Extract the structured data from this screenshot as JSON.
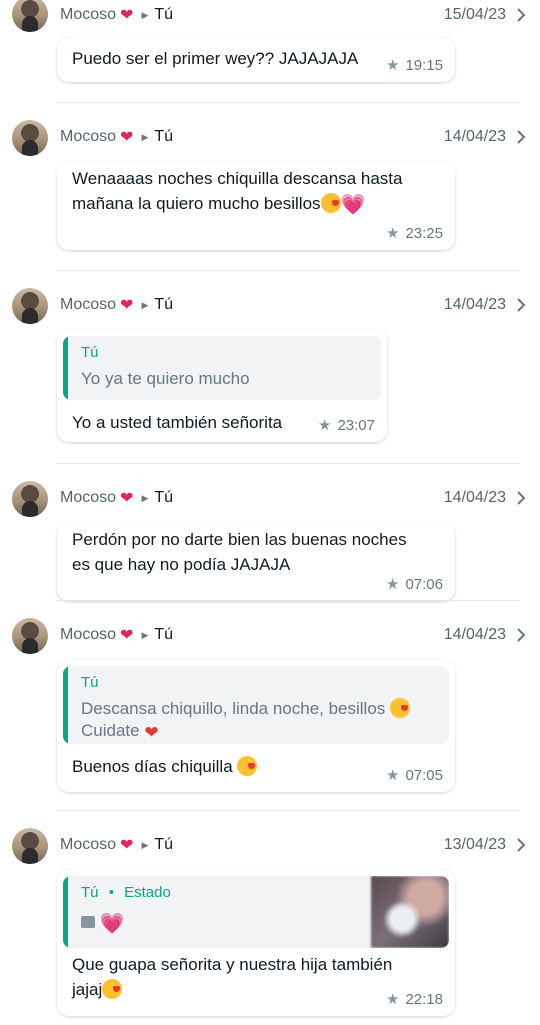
{
  "messages": [
    {
      "sender": "Mocoso",
      "recipient": "Tú",
      "date": "15/04/23",
      "text": "Puedo ser el primer wey?? JAJAJAJA",
      "time": "19:15"
    },
    {
      "sender": "Mocoso",
      "recipient": "Tú",
      "date": "14/04/23",
      "text_line1": "Wenaaaas noches chiquilla descansa hasta",
      "text_line2": "mañana la quiero mucho besillos",
      "time": "23:25"
    },
    {
      "sender": "Mocoso",
      "recipient": "Tú",
      "date": "14/04/23",
      "quote_author": "Tú",
      "quote_text": "Yo ya te quiero mucho",
      "text": "Yo a usted también señorita",
      "time": "23:07"
    },
    {
      "sender": "Mocoso",
      "recipient": "Tú",
      "date": "14/04/23",
      "text_line1": "Perdón por no darte bien las buenas noches",
      "text_line2": "es que hay no podía JAJAJA",
      "time": "07:06"
    },
    {
      "sender": "Mocoso",
      "recipient": "Tú",
      "date": "14/04/23",
      "quote_author": "Tú",
      "quote_line1": "Descansa chiquillo, linda noche, besillos",
      "quote_line2": "Cuidate",
      "text": "Buenos días chiquilla",
      "time": "07:05"
    },
    {
      "sender": "Mocoso",
      "recipient": "Tú",
      "date": "13/04/23",
      "quote_author": "Tú",
      "quote_source": "Estado",
      "text_line1": "Que guapa señorita y nuestra hija también",
      "text_line2": "jajaj",
      "time": "22:18"
    }
  ],
  "icons": {
    "favorite": "star-icon",
    "reaction": "heart",
    "forward": "chevron-right-icon",
    "status_media": "image-icon"
  },
  "colors": {
    "accent": "#06a884",
    "heart": "#e0245e",
    "text_secondary": "#667781"
  }
}
